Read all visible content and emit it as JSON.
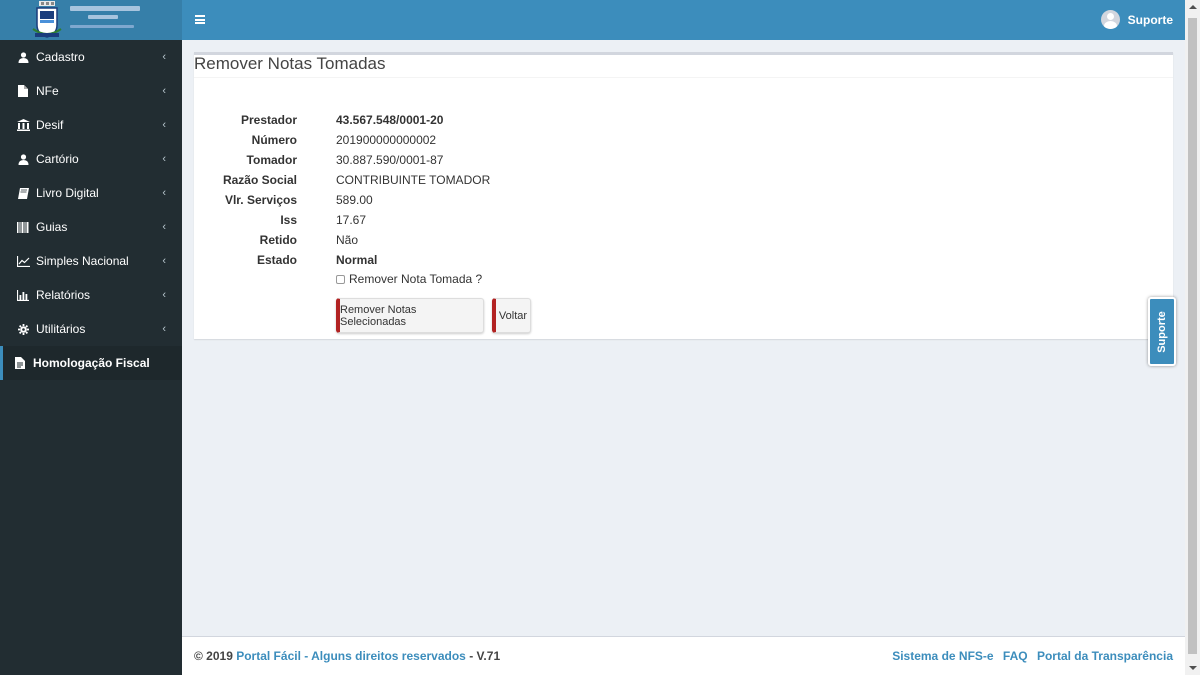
{
  "header": {
    "user_name": "Suporte"
  },
  "logo": {
    "alt": "Prefeitura Municipal"
  },
  "sidebar": {
    "items": [
      {
        "label": "Cadastro",
        "icon": "user-icon"
      },
      {
        "label": "NFe",
        "icon": "file-icon"
      },
      {
        "label": "Desif",
        "icon": "bank-icon"
      },
      {
        "label": "Cartório",
        "icon": "user-icon"
      },
      {
        "label": "Livro Digital",
        "icon": "book-icon"
      },
      {
        "label": "Guias",
        "icon": "barcode-icon"
      },
      {
        "label": "Simples Nacional",
        "icon": "line-chart-icon"
      },
      {
        "label": "Relatórios",
        "icon": "bar-chart-icon"
      },
      {
        "label": "Utilitários",
        "icon": "gear-icon"
      },
      {
        "label": "Homologação Fiscal",
        "icon": "file-text-icon",
        "active": true
      }
    ]
  },
  "main": {
    "title": "Remover Notas Tomadas",
    "fields": [
      {
        "label": "Prestador",
        "value": "43.567.548/0001-20",
        "bold": true
      },
      {
        "label": "Número",
        "value": "201900000000002"
      },
      {
        "label": "Tomador",
        "value": "30.887.590/0001-87"
      },
      {
        "label": "Razão Social",
        "value": "CONTRIBUINTE TOMADOR"
      },
      {
        "label": "Vlr. Serviços",
        "value": "589.00"
      },
      {
        "label": "Iss",
        "value": "17.67"
      },
      {
        "label": "Retido",
        "value": "Não"
      },
      {
        "label": "Estado",
        "value": "Normal",
        "bold": true
      }
    ],
    "checkbox_label": "Remover Nota Tomada ?",
    "checkbox_checked": false,
    "remove_button": "Remover Notas Selecionadas",
    "back_button": "Voltar"
  },
  "side_tab": {
    "label": "Suporte"
  },
  "footer": {
    "copyright": "© 2019",
    "brand": "Portal Fácil - Alguns direitos reservados",
    "version": "V.71",
    "links": [
      "Sistema de NFS-e",
      "FAQ",
      "Portal da Transparência"
    ]
  },
  "colors": {
    "accent": "#3c8dbc",
    "sidebar_bg": "#222d32",
    "button_border": "#b22222"
  }
}
